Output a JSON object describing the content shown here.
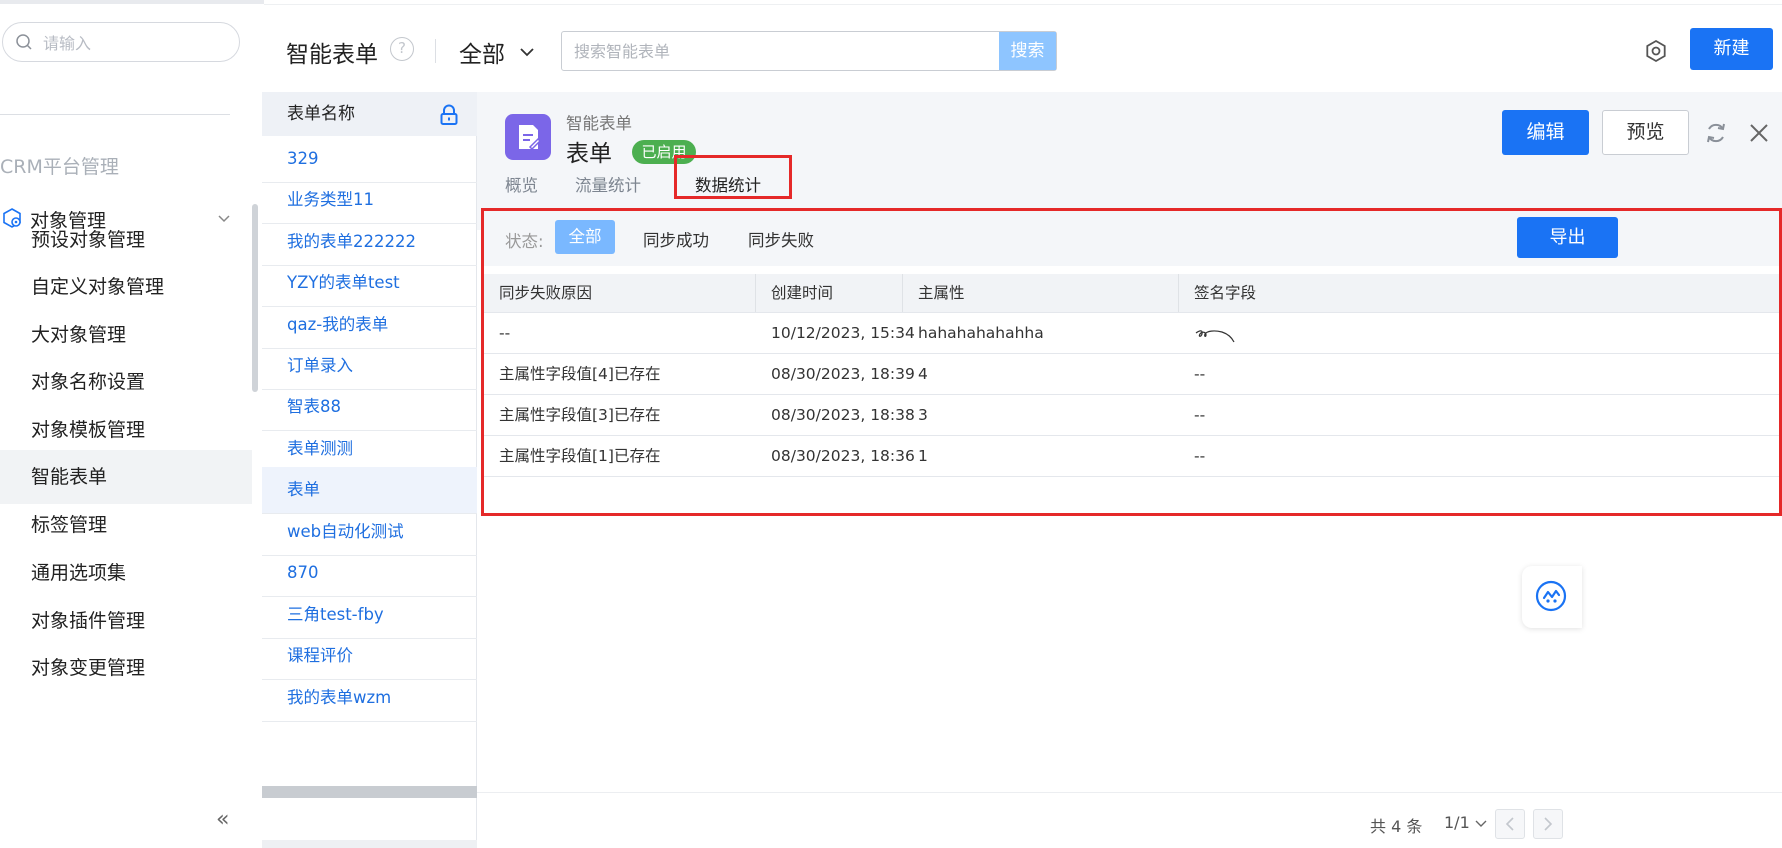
{
  "sidebar": {
    "search_placeholder": "请输入",
    "section_title": "CRM平台管理",
    "group_label": "对象管理",
    "items": [
      {
        "label": "预设对象管理"
      },
      {
        "label": "自定义对象管理"
      },
      {
        "label": "大对象管理"
      },
      {
        "label": "对象名称设置"
      },
      {
        "label": "对象模板管理"
      },
      {
        "label": "智能表单",
        "active": true
      },
      {
        "label": "标签管理"
      },
      {
        "label": "通用选项集"
      },
      {
        "label": "对象插件管理"
      },
      {
        "label": "对象变更管理"
      }
    ],
    "collapse_glyph": "«"
  },
  "header": {
    "title": "智能表单",
    "help_glyph": "?",
    "scope": "全部",
    "search_placeholder": "搜索智能表单",
    "search_button": "搜索",
    "new_button": "新建"
  },
  "form_list": {
    "column_header": "表单名称",
    "items": [
      {
        "label": "329"
      },
      {
        "label": "业务类型11"
      },
      {
        "label": "我的表单222222"
      },
      {
        "label": "YZY的表单test"
      },
      {
        "label": "qaz-我的表单"
      },
      {
        "label": "订单录入"
      },
      {
        "label": "智表88"
      },
      {
        "label": "表单测测"
      },
      {
        "label": "表单",
        "active": true
      },
      {
        "label": "web自动化测试"
      },
      {
        "label": "870"
      },
      {
        "label": "三角test-fby"
      },
      {
        "label": "课程评价"
      },
      {
        "label": "我的表单wzm"
      }
    ]
  },
  "detail": {
    "subtitle": "智能表单",
    "name": "表单",
    "status_badge": "已启用",
    "edit_button": "编辑",
    "preview_button": "预览",
    "tabs": [
      {
        "label": "概览"
      },
      {
        "label": "流量统计"
      },
      {
        "label": "数据统计",
        "active": true
      }
    ]
  },
  "stats": {
    "filter_label": "状态:",
    "filters": [
      {
        "label": "全部",
        "active": true
      },
      {
        "label": "同步成功"
      },
      {
        "label": "同步失败"
      }
    ],
    "export_button": "导出",
    "columns": [
      "同步失败原因",
      "创建时间",
      "主属性",
      "签名字段"
    ],
    "rows": [
      {
        "reason": "--",
        "created": "10/12/2023, 15:34",
        "main_attr": "hahahahahahha",
        "signature": "",
        "signature_is_image": true
      },
      {
        "reason": "主属性字段值[4]已存在",
        "created": "08/30/2023, 18:39",
        "main_attr": "4",
        "signature": "--"
      },
      {
        "reason": "主属性字段值[3]已存在",
        "created": "08/30/2023, 18:38",
        "main_attr": "3",
        "signature": "--"
      },
      {
        "reason": "主属性字段值[1]已存在",
        "created": "08/30/2023, 18:36",
        "main_attr": "1",
        "signature": "--"
      }
    ]
  },
  "pagination": {
    "total": "共 4 条",
    "page": "1/1"
  },
  "colors": {
    "primary": "#1a73f4",
    "highlight_border": "#e52929",
    "badge_green": "#4caf50",
    "form_icon_purple": "#7b66e8",
    "link_blue": "#1f6fe0"
  }
}
